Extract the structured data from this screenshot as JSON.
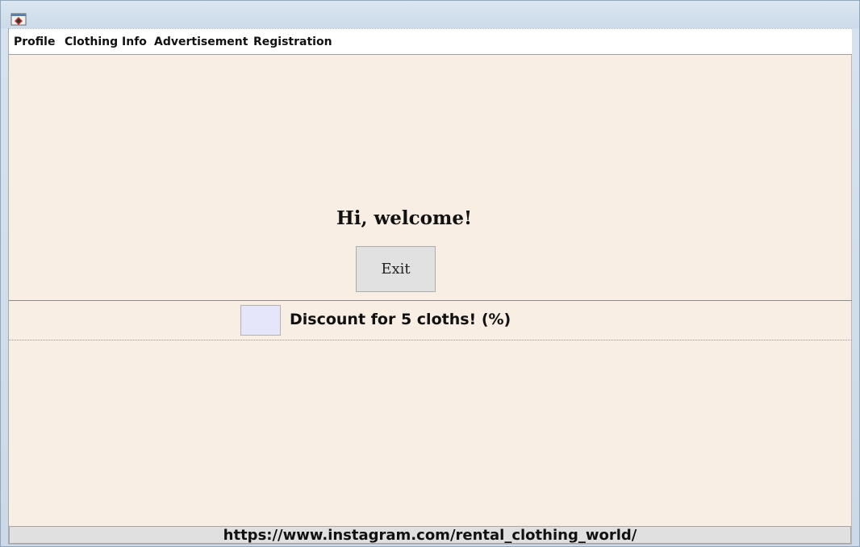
{
  "window": {
    "app_icon": "app-icon"
  },
  "menu": {
    "items": [
      {
        "label": "Profile"
      },
      {
        "label": "Clothing Info"
      },
      {
        "label": "Advertisement"
      },
      {
        "label": "Registration"
      }
    ]
  },
  "main": {
    "welcome_text": "Hi, welcome!",
    "exit_label": "Exit"
  },
  "discount": {
    "input_value": "",
    "label": "Discount for 5 cloths! (%)",
    "input_bg": "#e6e6fa"
  },
  "footer": {
    "link_text": "https://www.instagram.com/rental_clothing_world/"
  },
  "colors": {
    "content_bg": "#f9eee4",
    "button_bg": "#e1e1e1"
  }
}
